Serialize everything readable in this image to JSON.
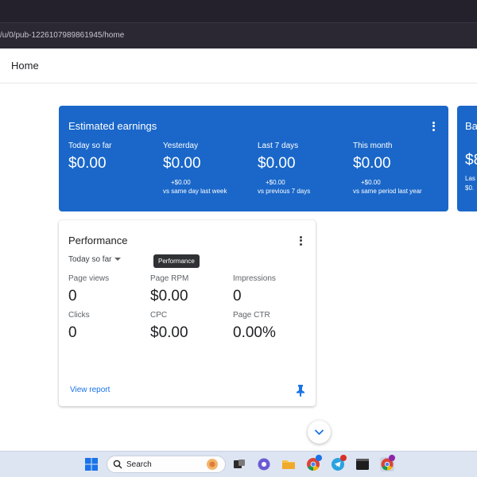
{
  "browser": {
    "url": "/u/0/pub-1226107989861945/home"
  },
  "header": {
    "title": "Home"
  },
  "earnings": {
    "title": "Estimated earnings",
    "metrics": [
      {
        "label": "Today so far",
        "value": "$0.00",
        "delta": "",
        "comparison": ""
      },
      {
        "label": "Yesterday",
        "value": "$0.00",
        "delta": "+$0.00",
        "comparison": "vs same day last week"
      },
      {
        "label": "Last 7 days",
        "value": "$0.00",
        "delta": "+$0.00",
        "comparison": "vs previous 7 days"
      },
      {
        "label": "This month",
        "value": "$0.00",
        "delta": "+$0.00",
        "comparison": "vs same period last year"
      }
    ]
  },
  "balance": {
    "title": "Ba",
    "value": "$8",
    "sub1": "Las",
    "sub2": "$0."
  },
  "performance": {
    "title": "Performance",
    "range": "Today so far",
    "tooltip": "Performance",
    "metrics": [
      {
        "label": "Page views",
        "value": "0"
      },
      {
        "label": "Page RPM",
        "value": "$0.00"
      },
      {
        "label": "Impressions",
        "value": "0"
      },
      {
        "label": "Clicks",
        "value": "0"
      },
      {
        "label": "CPC",
        "value": "$0.00"
      },
      {
        "label": "Page CTR",
        "value": "0.00%"
      }
    ],
    "view_report": "View report"
  },
  "taskbar": {
    "search_placeholder": "Search"
  },
  "colors": {
    "accent_blue": "#1a67c9",
    "link_blue": "#1a73e8"
  }
}
